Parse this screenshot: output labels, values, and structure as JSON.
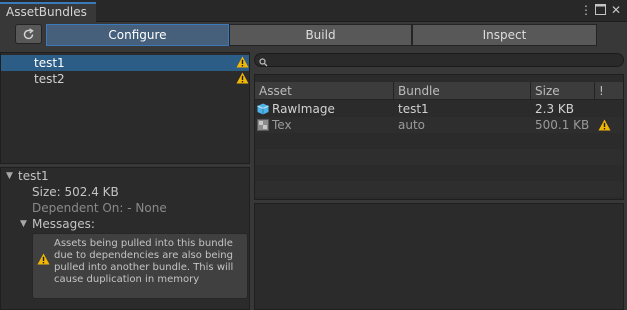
{
  "window": {
    "tab_title": "AssetBundles",
    "menu_icon": "kebab-menu-icon",
    "maximize_icon": "maximize-icon",
    "close_icon": "close-icon"
  },
  "toolbar": {
    "refresh_icon": "refresh-icon",
    "modes": [
      {
        "label": "Configure",
        "active": true
      },
      {
        "label": "Build",
        "active": false
      },
      {
        "label": "Inspect",
        "active": false
      }
    ]
  },
  "bundles": [
    {
      "name": "test1",
      "selected": true,
      "warning": true
    },
    {
      "name": "test2",
      "selected": false,
      "warning": true
    }
  ],
  "details": {
    "bundle_name": "test1",
    "size": "Size: 502.4 KB",
    "dependent_on": "Dependent On: - None",
    "messages_label": "Messages:",
    "message": "Assets being pulled into this bundle due to dependencies are also being pulled into another bundle.  This will cause duplication in memory"
  },
  "search": {
    "placeholder": "",
    "icon": "search-icon"
  },
  "asset_table": {
    "columns": [
      "Asset",
      "Bundle",
      "Size",
      "!"
    ],
    "rows": [
      {
        "asset": "RawImage",
        "icon": "cube-prefab-icon",
        "bundle": "test1",
        "size": "2.3 KB",
        "warning": false
      },
      {
        "asset": "Tex",
        "icon": "texture-icon",
        "bundle": "auto",
        "size": "500.1 KB",
        "warning": true
      }
    ]
  },
  "colors": {
    "accent": "#3a79bb",
    "selected_row": "#2c5d87",
    "warning": "#f2b705"
  }
}
